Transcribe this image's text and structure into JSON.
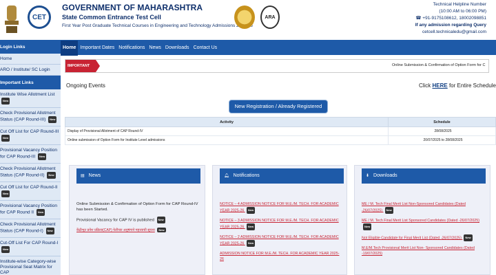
{
  "header": {
    "title": "GOVERNMENT OF MAHARASHTRA",
    "subtitle": "State Common Entrance Test Cell",
    "line": "First Year Post Graduate Technical Courses in Engineering and Technology Admissions 2025-26",
    "cet_logo_text": "CET",
    "seal2_text": "ARA",
    "helpline_title": "Technical Helpline Number",
    "helpline_hours": "(10:00 AM to 06:00 PM)",
    "helpline_numbers": "☎ +91-9175108612, 18002098851",
    "query_text": "If any admission regarding Query",
    "email": "cetcell.technicaledu@gmail.com"
  },
  "sidebar": {
    "login_head": "Login Links",
    "home": "Home",
    "login_item": "ARO / Institute/ SC Login",
    "important_head": "Important Links",
    "items": [
      {
        "label": "Institute Wise Allotment List",
        "new": "New"
      },
      {
        "label": "Check Provisional Allotment Status (CAP Round-III)",
        "new": "New"
      },
      {
        "label": "Cut Off List for CAP Round-III",
        "new": "New"
      },
      {
        "label": "Provisional Vacancy Position for CAP Round-III",
        "new": "New"
      },
      {
        "label": "Check Provisional Allotment Status (CAP Round-II)",
        "new": "New"
      },
      {
        "label": "Cut Off List for CAP Round-II",
        "new": "New"
      },
      {
        "label": "Provisional Vacancy Position for CAP Round II",
        "new": "New"
      },
      {
        "label": "Check Provisional Allotment Status (CAP Round-I)",
        "new": "New"
      },
      {
        "label": "Cut-Off List For CAP Round-I",
        "new": "New"
      },
      {
        "label": "Institute-wise Category-wise Provisional Seat Matrix for CAP",
        "new": ""
      }
    ]
  },
  "nav": [
    "Home",
    "Important Dates",
    "Notifications",
    "News",
    "Downloads",
    "Contact Us"
  ],
  "ticker": {
    "label": "IMPORTANT",
    "text": "Online Submission & Confirmation of Option Form for C"
  },
  "ongoing": {
    "title": "Ongoing Events",
    "click": "Click ",
    "here": "HERE",
    "rest": " for Entire Schedule"
  },
  "register_button": "New Registration / Already Registered",
  "schedule": {
    "headers": [
      "Activity",
      "Schedule"
    ],
    "rows": [
      {
        "activity": "Display of Provisional Allotment of CAP Round-IV",
        "date": "28/08/2025"
      },
      {
        "activity": "Online submission of Option Form for Institute Level admissions",
        "date": "20/07/2025 to 28/08/2025"
      }
    ]
  },
  "news": {
    "title": "News",
    "items": [
      "Online Submission & Confirmation of Option Form for CAP Round-IV has been Started.",
      "Provisional Vacancy for CAP IV is published"
    ],
    "marathi": "केंद्रीभूत प्रवेश प्रक्रिया(CAP) फेरीच्या अनुषंगाने महत्त्वाची सूचना",
    "new": "New"
  },
  "notifications": {
    "title": "Notifications",
    "items": [
      "NOTICE – 4 ADMISSION NOTICE FOR M.E./M. TECH. FOR ACADEMIC YEAR 2025-26",
      "NOTICE – 3 ADMISSION NOTICE FOR M.E./M. TECH. FOR ACADEMIC YEAR 2025-26",
      "NOTICE – 2 ADMISSION NOTICE FOR M.E./M. TECH. FOR ACADEMIC YEAR 2025-26",
      "ADMISSION NOTICE FOR M.E./M. TECH. FOR ACADEMIC YEAR 2025-26"
    ],
    "new": "New"
  },
  "downloads": {
    "title": "Downloads",
    "items": [
      "ME / M. Tech Final Merit List Non-Sponsored Candidates (Dated -26/07/2025)",
      "ME / M. Tech Final Merit List Sponsored Candidates (Dated -26/07/2025)",
      "Not Eligible Candidate for Final Merit List (Dated -26/07/2025)",
      "M.E/M.Tech Provisional Merit List Non- Sponsored Candidates (Dated -19/07/2025)"
    ],
    "new": "New"
  }
}
